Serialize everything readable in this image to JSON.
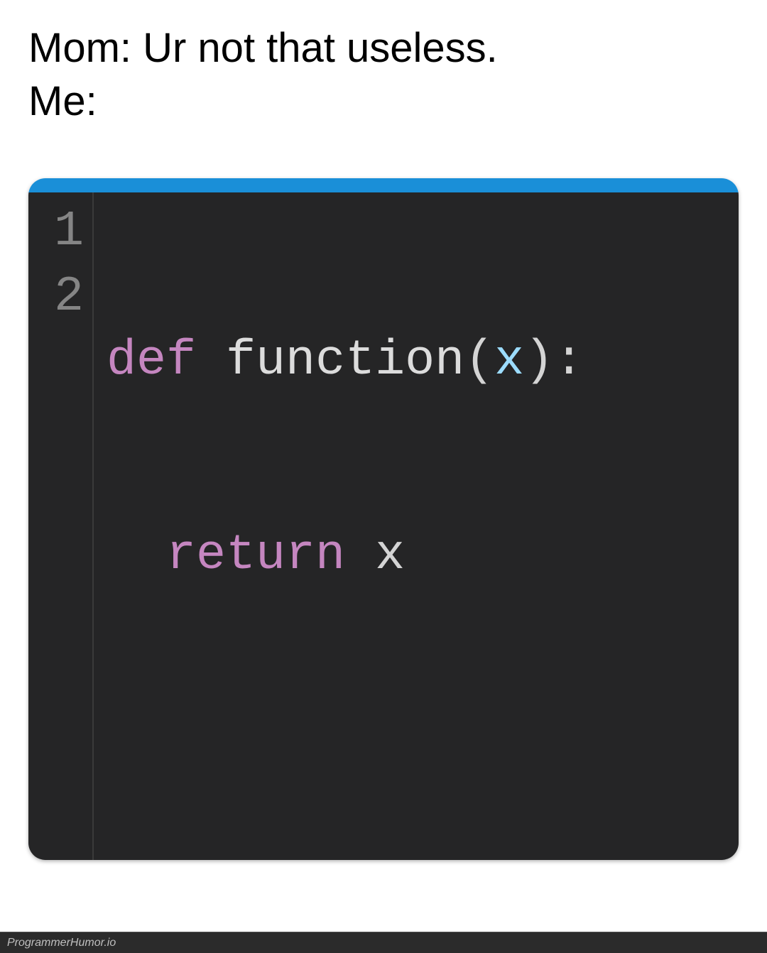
{
  "caption": {
    "line1": "Mom: Ur not that useless.",
    "line2": "Me:"
  },
  "editor": {
    "gutter": [
      "1",
      "2"
    ],
    "code": {
      "line1": {
        "def": "def",
        "space1": " ",
        "name": "function",
        "lparen": "(",
        "param": "x",
        "rparen": ")",
        "colon": ":"
      },
      "line2": {
        "indent": "  ",
        "return": "return",
        "space": " ",
        "var": "x"
      }
    }
  },
  "footer": {
    "watermark": "ProgrammerHumor.io"
  }
}
